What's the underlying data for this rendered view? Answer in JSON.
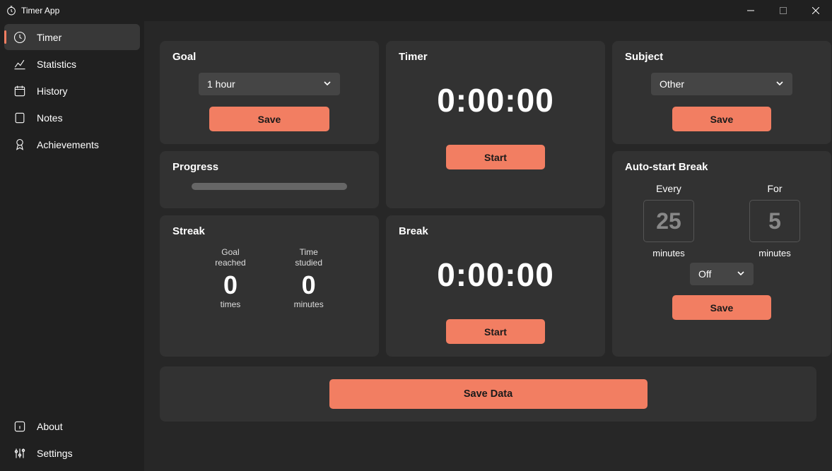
{
  "window": {
    "title": "Timer App"
  },
  "sidebar": {
    "top": [
      {
        "label": "Timer",
        "icon": "clock"
      },
      {
        "label": "Statistics",
        "icon": "chart-line"
      },
      {
        "label": "History",
        "icon": "calendar"
      },
      {
        "label": "Notes",
        "icon": "note"
      },
      {
        "label": "Achievements",
        "icon": "medal"
      }
    ],
    "bottom": [
      {
        "label": "About",
        "icon": "info"
      },
      {
        "label": "Settings",
        "icon": "sliders"
      }
    ],
    "selected_index": 0
  },
  "goal": {
    "title": "Goal",
    "selected": "1 hour",
    "save_label": "Save"
  },
  "progress": {
    "title": "Progress",
    "percent": 0
  },
  "streak": {
    "title": "Streak",
    "goal_reached_label": "Goal\nreached",
    "goal_reached_value": "0",
    "goal_reached_unit": "times",
    "time_studied_label": "Time\nstudied",
    "time_studied_value": "0",
    "time_studied_unit": "minutes"
  },
  "timer": {
    "title": "Timer",
    "display": "0:00:00",
    "start_label": "Start"
  },
  "break": {
    "title": "Break",
    "display": "0:00:00",
    "start_label": "Start"
  },
  "subject": {
    "title": "Subject",
    "selected": "Other",
    "save_label": "Save"
  },
  "auto_break": {
    "title": "Auto-start Break",
    "every_label": "Every",
    "every_value": "25",
    "every_unit": "minutes",
    "for_label": "For",
    "for_value": "5",
    "for_unit": "minutes",
    "toggle_selected": "Off",
    "save_label": "Save"
  },
  "footer": {
    "save_data_label": "Save Data"
  }
}
